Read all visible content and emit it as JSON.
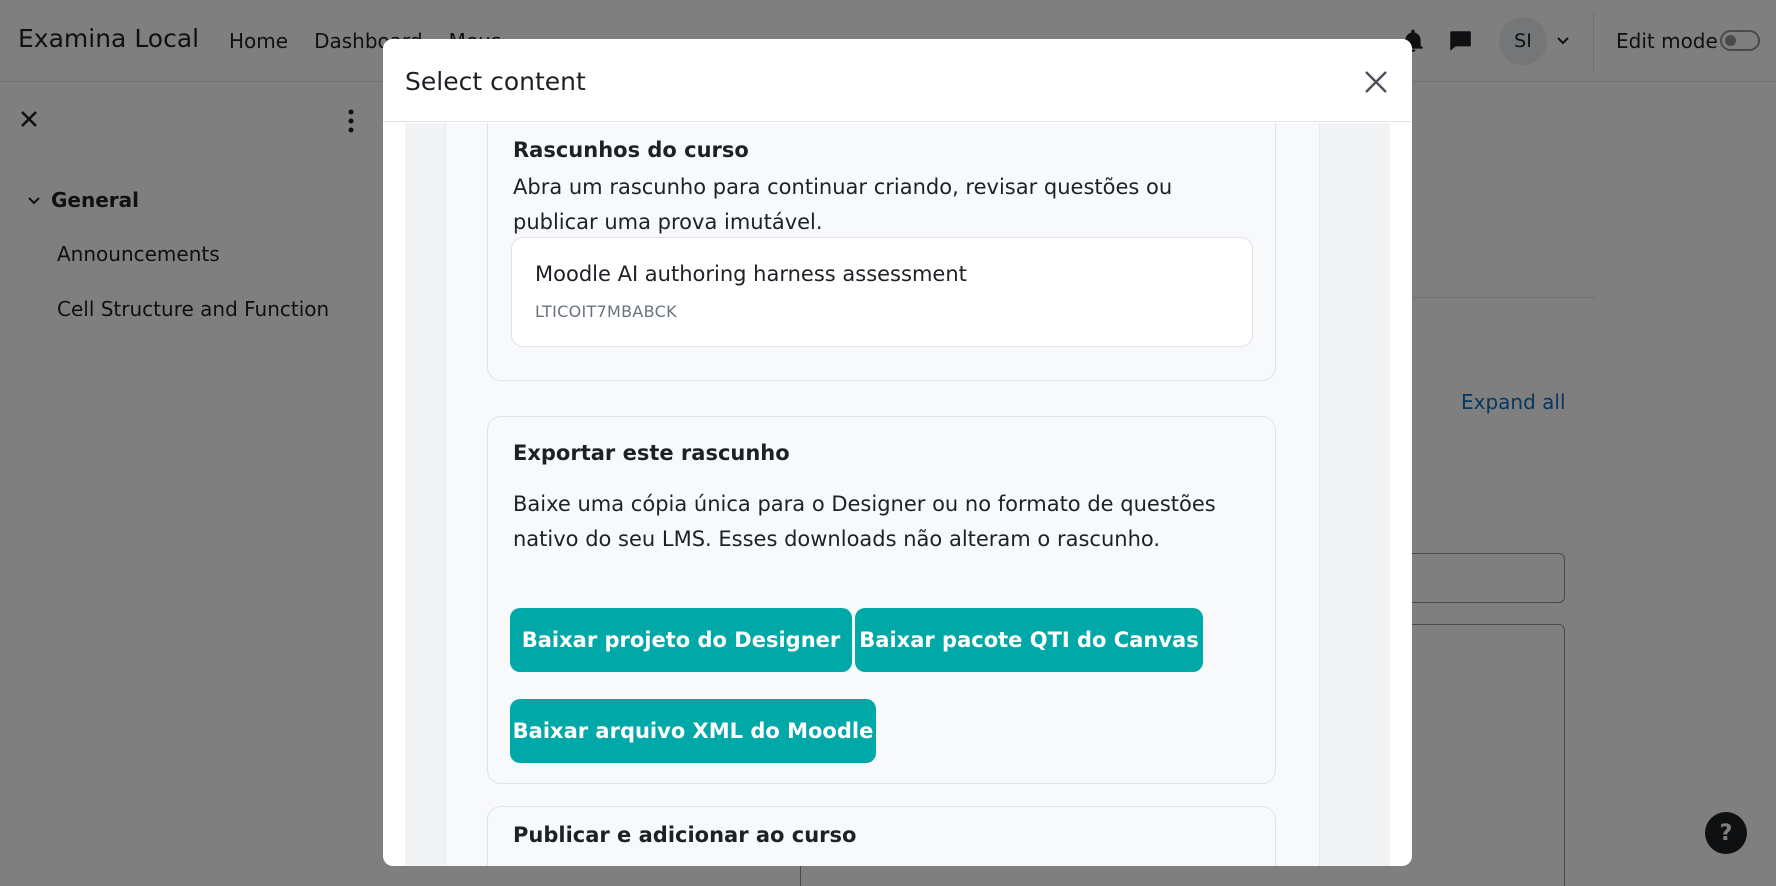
{
  "navbar": {
    "brand": "Examina Local",
    "links": [
      "Home",
      "Dashboard",
      "Meus..."
    ],
    "user_initials": "SI",
    "edit_mode_label": "Edit mode"
  },
  "drawer": {
    "section_label": "General",
    "items": [
      "Announcements",
      "Cell Structure and Function"
    ]
  },
  "background": {
    "expand_all": "Expand all",
    "help": "?"
  },
  "modal": {
    "title": "Select content",
    "drafts_card": {
      "title": "Rascunhos do curso",
      "description": "Abra um rascunho para continuar criando, revisar questões ou publicar uma prova imutável.",
      "draft": {
        "name": "Moodle AI authoring harness assessment",
        "code": "LTICOIT7MBABCK"
      }
    },
    "export_card": {
      "title": "Exportar este rascunho",
      "description": "Baixe uma cópia única para o Designer ou no formato de questões nativo do seu LMS. Esses downloads não alteram o rascunho.",
      "buttons": [
        "Baixar projeto do Designer",
        "Baixar pacote QTI do Canvas",
        "Baixar arquivo XML do Moodle"
      ]
    },
    "publish_card": {
      "title": "Publicar e adicionar ao curso"
    }
  },
  "colors": {
    "accent": "#00a9a8",
    "link": "#0f6cbf",
    "backdrop": "rgba(0,0,0,0.5)"
  }
}
